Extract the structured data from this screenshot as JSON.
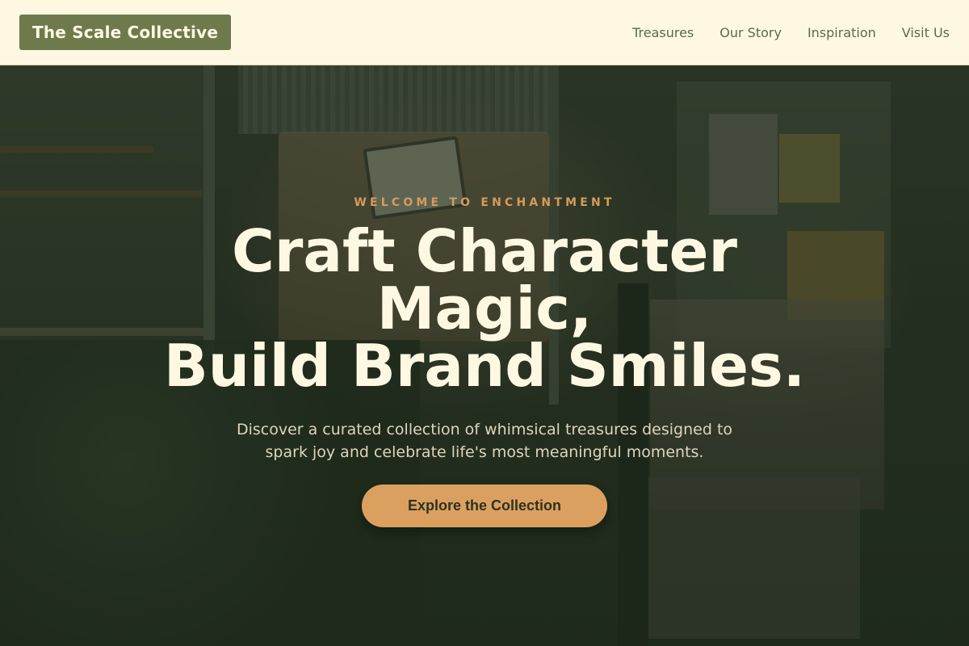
{
  "brand": {
    "name": "The Scale Collective"
  },
  "nav": {
    "items": [
      {
        "label": "Treasures"
      },
      {
        "label": "Our Story"
      },
      {
        "label": "Inspiration"
      },
      {
        "label": "Visit Us"
      }
    ]
  },
  "hero": {
    "eyebrow": "WELCOME TO ENCHANTMENT",
    "headline_line1": "Craft Character",
    "headline_line2": "Magic,",
    "headline_line3": "Build Brand Smiles.",
    "subtext": "Discover a curated collection of whimsical treasures designed to spark joy and celebrate life's most meaningful moments.",
    "cta_label": "Explore the Collection"
  },
  "colors": {
    "nav_background": "#fef8e3",
    "logo_background": "#6e7a4c",
    "nav_text": "#5d6a42",
    "eyebrow": "#d79a5a",
    "headline": "#fef8e3",
    "cta_background": "#dba060",
    "cta_text": "#2c331f"
  }
}
